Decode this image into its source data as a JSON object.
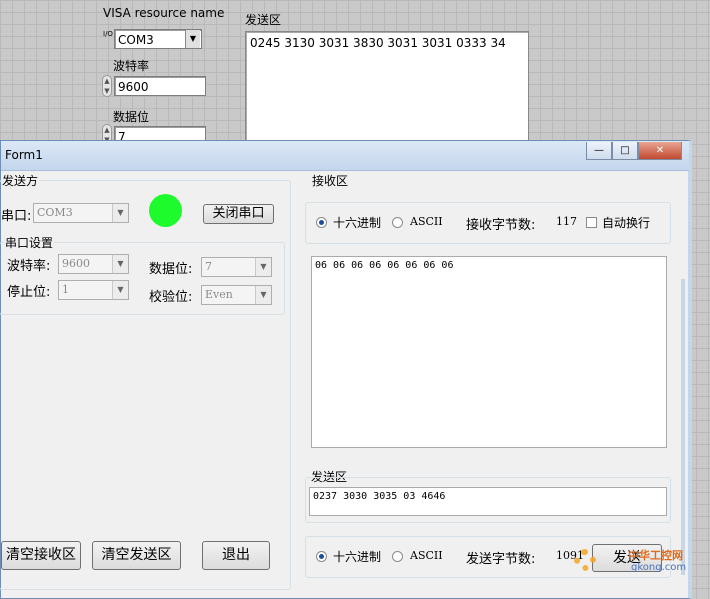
{
  "labview": {
    "visa_label": "VISA resource name",
    "visa_value": "COM3",
    "visa_prefix": "I/O",
    "baud_label": "波特率",
    "baud_value": "9600",
    "databits_label": "数据位",
    "databits_value": "7",
    "send_label": "发送区",
    "send_value": "0245 3130 3031 3830 3031 3031 0333 34"
  },
  "form": {
    "title": "Form1",
    "minimize": "—",
    "maximize": "□",
    "close": "✕",
    "sender": {
      "group_label": "发送方",
      "port_label": "串口:",
      "port_value": "COM3",
      "status_color": "#1dfb2c",
      "close_port_button": "关闭串口",
      "settings_label": "串口设置",
      "baud_label": "波特率:",
      "baud_value": "9600",
      "stop_label": "停止位:",
      "stop_value": "1",
      "databits_label": "数据位:",
      "databits_value": "7",
      "parity_label": "校验位:",
      "parity_value": "Even",
      "clear_receive_button": "清空接收区",
      "clear_send_button": "清空发送区",
      "exit_button": "退出"
    },
    "receive": {
      "group_label": "接收区",
      "hex_option": "十六进制",
      "ascii_option": "ASCII",
      "hex_selected": true,
      "count_label": "接收字节数:",
      "count_value": "117",
      "wrap_label": "自动换行",
      "content": "06 06 06 06 06 06 06 06"
    },
    "send": {
      "group_label": "发送区",
      "content": "0237 3030 3035 03 4646",
      "hex_option": "十六进制",
      "ascii_option": "ASCII",
      "count_label": "发送字节数:",
      "count_value": "1091",
      "send_button": "发送"
    }
  },
  "watermark": {
    "text": "中华工控网",
    "url": "gkong.com"
  }
}
